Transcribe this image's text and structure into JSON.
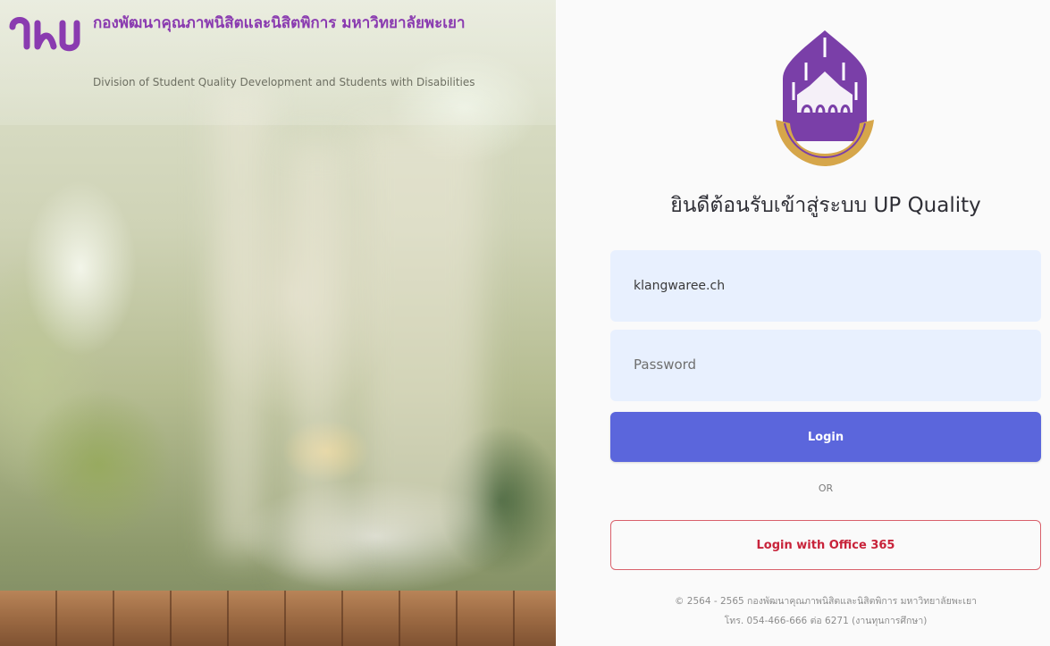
{
  "branding": {
    "org_name_th": "กองพัฒนาคุณภาพนิสิตและนิสิตพิการ มหาวิทยาลัยพะเยา",
    "org_name_en": "Division of Student Quality Development and Students with Disabilities",
    "logo_text": "มพ",
    "brand_color": "#8a3bb0"
  },
  "login": {
    "welcome": "ยินดีต้อนรับเข้าสู่ระบบ UP Quality",
    "username_value": "klangwaree.ch",
    "password_placeholder": "Password",
    "login_label": "Login",
    "or_label": "OR",
    "office365_label": "Login with Office 365",
    "accent_color": "#5b66dc",
    "office_color": "#c8233a"
  },
  "footer": {
    "line1": "© 2564 - 2565 กองพัฒนาคุณภาพนิสิตและนิสิตพิการ มหาวิทยาลัยพะเยา",
    "line2": "โทร. 054-466-666 ต่อ 6271 (งานทุนการศึกษา)"
  },
  "icons": {
    "logo": "university-logo-icon",
    "emblem": "university-emblem-icon"
  }
}
